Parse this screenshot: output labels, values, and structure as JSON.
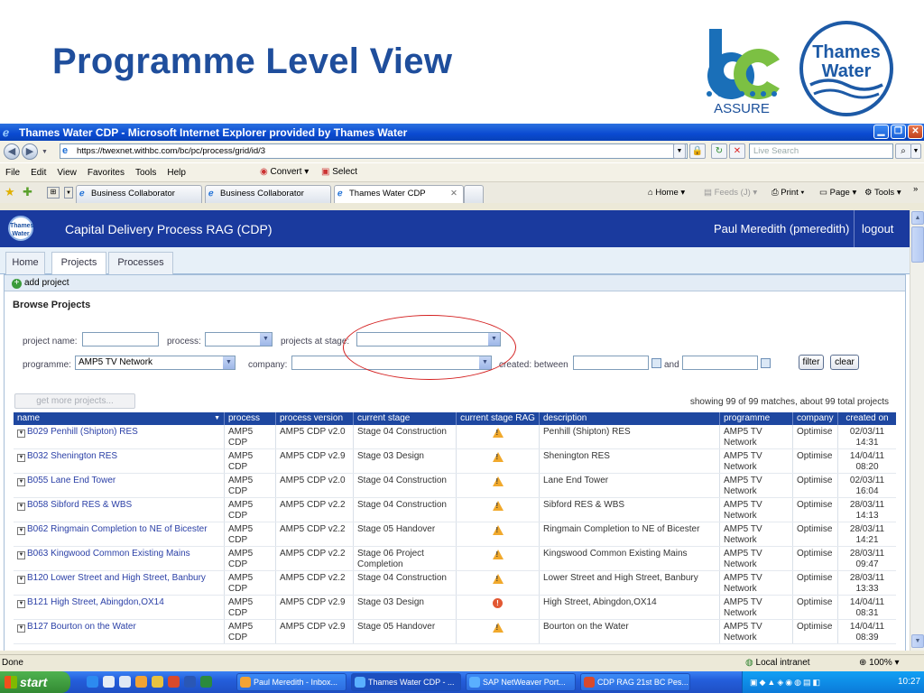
{
  "slide": {
    "title": "Programme Level View",
    "bc_logo_text": "ASSURE",
    "tw_logo_line1": "Thames",
    "tw_logo_line2": "Water"
  },
  "browser": {
    "window_title": "Thames Water CDP - Microsoft Internet Explorer provided by Thames Water",
    "url": "https://twexnet.withbc.com/bc/pc/process/grid/id/3",
    "search_placeholder": "Live Search",
    "menu": [
      "File",
      "Edit",
      "View",
      "Favorites",
      "Tools",
      "Help"
    ],
    "convert_label": "Convert",
    "select_label": "Select",
    "tabs": [
      "Business Collaborator",
      "Business Collaborator",
      "Thames Water CDP"
    ],
    "cmd_home": "Home",
    "cmd_feeds": "Feeds (J)",
    "cmd_print": "Print",
    "cmd_page": "Page",
    "cmd_tools": "Tools",
    "status_text": "Done",
    "zone_text": "Local intranet",
    "zoom_text": "100%"
  },
  "app": {
    "logo_text": "Thames Water",
    "title": "Capital Delivery Process RAG (CDP)",
    "user": "Paul Meredith (pmeredith)",
    "logout": "logout",
    "nav_tabs": [
      "Home",
      "Projects",
      "Processes"
    ],
    "add_project": "add project",
    "browse_title": "Browse Projects"
  },
  "filters": {
    "project_name_label": "project name:",
    "process_label": "process:",
    "stage_label": "projects at stage:",
    "programme_label": "programme:",
    "programme_value": "AMP5 TV Network",
    "company_label": "company:",
    "created_label": "created: between",
    "and_label": "and",
    "filter_btn": "filter",
    "clear_btn": "clear",
    "get_more": "get more projects...",
    "showing": "showing 99 of 99 matches, about 99 total projects"
  },
  "table": {
    "headers": [
      "name",
      "process",
      "process version",
      "current stage",
      "current stage RAG",
      "description",
      "programme",
      "company",
      "created on"
    ],
    "rows": [
      {
        "name": "B029 Penhill (Shipton) RES",
        "proc1": "AMP5",
        "proc2": "CDP",
        "version": "AMP5 CDP v2.0",
        "stage1": "Stage 04 Construction",
        "stage2": "",
        "rag": "amber",
        "desc": "Penhill (Shipton) RES",
        "prog1": "AMP5 TV",
        "prog2": "Network",
        "company": "Optimise",
        "date": "02/03/11",
        "time": "14:31"
      },
      {
        "name": "B032 Shenington RES",
        "proc1": "AMP5",
        "proc2": "CDP",
        "version": "AMP5 CDP v2.9",
        "stage1": "Stage 03 Design",
        "stage2": "",
        "rag": "amber",
        "desc": "Shenington RES",
        "prog1": "AMP5 TV",
        "prog2": "Network",
        "company": "Optimise",
        "date": "14/04/11",
        "time": "08:20"
      },
      {
        "name": "B055 Lane End Tower",
        "proc1": "AMP5",
        "proc2": "CDP",
        "version": "AMP5 CDP v2.0",
        "stage1": "Stage 04 Construction",
        "stage2": "",
        "rag": "amber",
        "desc": "Lane End Tower",
        "prog1": "AMP5 TV",
        "prog2": "Network",
        "company": "Optimise",
        "date": "02/03/11",
        "time": "16:04"
      },
      {
        "name": "B058 Sibford RES & WBS",
        "proc1": "AMP5",
        "proc2": "CDP",
        "version": "AMP5 CDP v2.2",
        "stage1": "Stage 04 Construction",
        "stage2": "",
        "rag": "amber",
        "desc": "Sibford RES & WBS",
        "prog1": "AMP5 TV",
        "prog2": "Network",
        "company": "Optimise",
        "date": "28/03/11",
        "time": "14:13"
      },
      {
        "name": "B062 Ringmain Completion to NE of Bicester",
        "proc1": "AMP5",
        "proc2": "CDP",
        "version": "AMP5 CDP v2.2",
        "stage1": "Stage 05 Handover",
        "stage2": "",
        "rag": "amber",
        "desc": "Ringmain Completion to NE of Bicester",
        "prog1": "AMP5 TV",
        "prog2": "Network",
        "company": "Optimise",
        "date": "28/03/11",
        "time": "14:21"
      },
      {
        "name": "B063 Kingwood Common Existing Mains",
        "proc1": "AMP5",
        "proc2": "CDP",
        "version": "AMP5 CDP v2.2",
        "stage1": "Stage 06 Project",
        "stage2": "Completion",
        "rag": "amber",
        "desc": "Kingswood Common Existing Mains",
        "prog1": "AMP5 TV",
        "prog2": "Network",
        "company": "Optimise",
        "date": "28/03/11",
        "time": "09:47"
      },
      {
        "name": "B120 Lower Street and High Street, Banbury",
        "proc1": "AMP5",
        "proc2": "CDP",
        "version": "AMP5 CDP v2.2",
        "stage1": "Stage 04 Construction",
        "stage2": "",
        "rag": "amber",
        "desc": "Lower Street and High Street, Banbury",
        "prog1": "AMP5 TV",
        "prog2": "Network",
        "company": "Optimise",
        "date": "28/03/11",
        "time": "13:33"
      },
      {
        "name": "B121 High Street, Abingdon,OX14",
        "proc1": "AMP5",
        "proc2": "CDP",
        "version": "AMP5 CDP v2.9",
        "stage1": "Stage 03 Design",
        "stage2": "",
        "rag": "red",
        "desc": "High Street, Abingdon,OX14",
        "prog1": "AMP5 TV",
        "prog2": "Network",
        "company": "Optimise",
        "date": "14/04/11",
        "time": "08:31"
      },
      {
        "name": "B127 Bourton on the Water",
        "proc1": "AMP5",
        "proc2": "CDP",
        "version": "AMP5 CDP v2.9",
        "stage1": "Stage 05 Handover",
        "stage2": "",
        "rag": "amber",
        "desc": "Bourton on the Water",
        "prog1": "AMP5 TV",
        "prog2": "Network",
        "company": "Optimise",
        "date": "14/04/11",
        "time": "08:39"
      }
    ]
  },
  "taskbar": {
    "start": "start",
    "tasks": [
      "Paul Meredith - Inbox...",
      "Thames Water CDP - ...",
      "SAP NetWeaver Port...",
      "CDP RAG 21st BC Pes..."
    ],
    "clock": "10:27"
  },
  "colors": {
    "title_blue": "#1f4e9c",
    "app_header": "#1a3a9e",
    "rag_amber": "#f1a92c",
    "rag_red": "#e25833"
  }
}
